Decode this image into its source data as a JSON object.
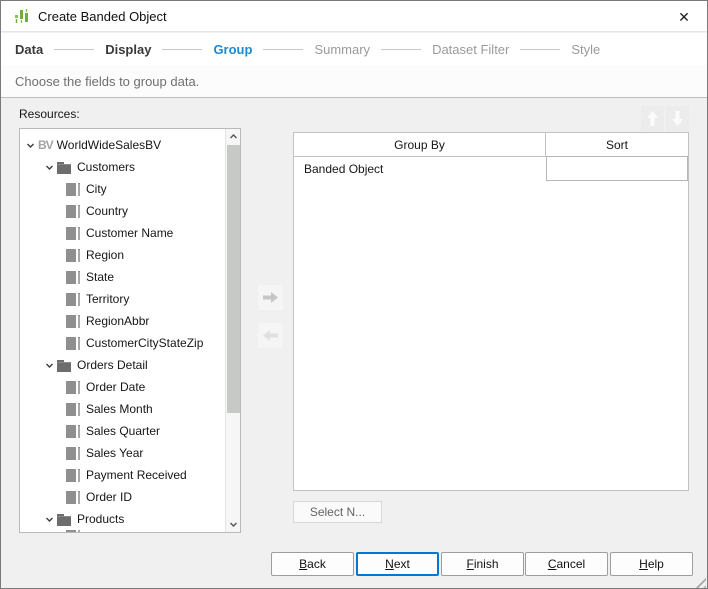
{
  "window": {
    "title": "Create Banded Object"
  },
  "steps": {
    "items": [
      {
        "label": "Data",
        "state": "done"
      },
      {
        "label": "Display",
        "state": "done"
      },
      {
        "label": "Group",
        "state": "active"
      },
      {
        "label": "Summary",
        "state": "todo"
      },
      {
        "label": "Dataset Filter",
        "state": "todo"
      },
      {
        "label": "Style",
        "state": "todo"
      }
    ]
  },
  "subtitle": "Choose the fields to group data.",
  "resources": {
    "label": "Resources:",
    "tree": [
      {
        "label": "WorldWideSalesBV",
        "type": "business-view",
        "expanded": true
      },
      {
        "label": "Customers",
        "type": "folder",
        "expanded": true
      },
      {
        "label": "City",
        "type": "field"
      },
      {
        "label": "Country",
        "type": "field"
      },
      {
        "label": "Customer Name",
        "type": "field"
      },
      {
        "label": "Region",
        "type": "field"
      },
      {
        "label": "State",
        "type": "field"
      },
      {
        "label": "Territory",
        "type": "field"
      },
      {
        "label": "RegionAbbr",
        "type": "field"
      },
      {
        "label": "CustomerCityStateZip",
        "type": "field"
      },
      {
        "label": "Orders Detail",
        "type": "folder",
        "expanded": true
      },
      {
        "label": "Order Date",
        "type": "field"
      },
      {
        "label": "Sales Month",
        "type": "field"
      },
      {
        "label": "Sales Quarter",
        "type": "field"
      },
      {
        "label": "Sales Year",
        "type": "field"
      },
      {
        "label": "Payment Received",
        "type": "field"
      },
      {
        "label": "Order ID",
        "type": "field"
      },
      {
        "label": "Products",
        "type": "folder",
        "expanded": true
      }
    ]
  },
  "group_table": {
    "columns": [
      "Group By",
      "Sort"
    ],
    "rows": [
      {
        "group_by": "Banded Object",
        "sort": ""
      }
    ]
  },
  "actions": {
    "select_n": "Select N...",
    "back": "Back",
    "next": "Next",
    "finish": "Finish",
    "cancel": "Cancel",
    "help": "Help"
  },
  "colors": {
    "active_step": "#1e88d2",
    "next_button_border": "#0078d7",
    "app_icon_green": "#6fae3e"
  }
}
